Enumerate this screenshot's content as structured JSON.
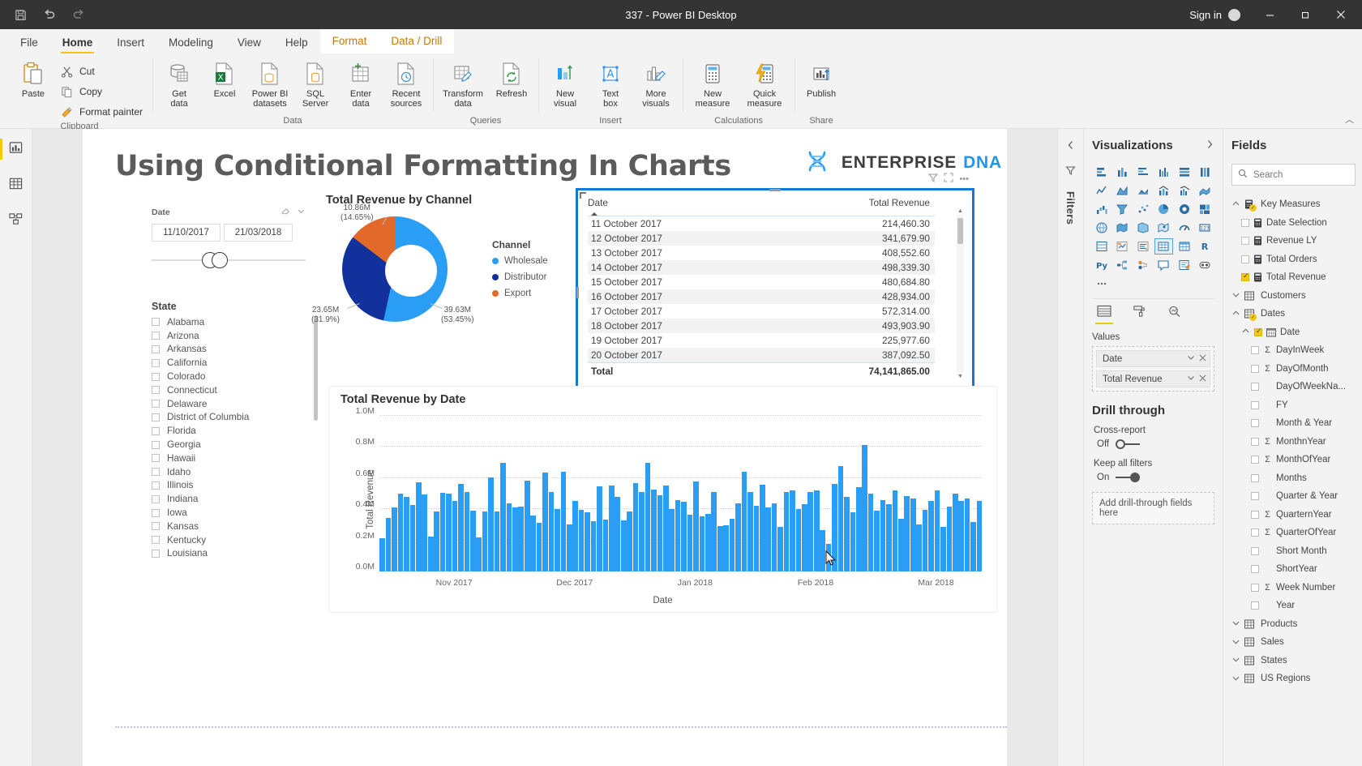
{
  "window": {
    "title": "337 - Power BI Desktop",
    "sign_in": "Sign in",
    "quick_access": [
      "save-icon",
      "undo-icon",
      "redo-icon"
    ],
    "controls": [
      "minimize-icon",
      "restore-icon",
      "close-icon"
    ]
  },
  "ribbon": {
    "tabs": [
      {
        "label": "File",
        "active": false,
        "contextual": false
      },
      {
        "label": "Home",
        "active": true,
        "contextual": false
      },
      {
        "label": "Insert",
        "active": false,
        "contextual": false
      },
      {
        "label": "Modeling",
        "active": false,
        "contextual": false
      },
      {
        "label": "View",
        "active": false,
        "contextual": false
      },
      {
        "label": "Help",
        "active": false,
        "contextual": false
      },
      {
        "label": "Format",
        "active": false,
        "contextual": true
      },
      {
        "label": "Data / Drill",
        "active": false,
        "contextual": true
      }
    ],
    "groups": [
      {
        "label": "Clipboard",
        "big": [
          {
            "label": "Paste",
            "icon": "paste-icon"
          }
        ],
        "small": [
          {
            "label": "Cut",
            "icon": "cut-icon"
          },
          {
            "label": "Copy",
            "icon": "copy-icon"
          },
          {
            "label": "Format painter",
            "icon": "format-painter-icon"
          }
        ]
      },
      {
        "label": "Data",
        "buttons": [
          {
            "label": "Get\ndata",
            "icon": "get-data-icon",
            "caret": true
          },
          {
            "label": "Excel",
            "icon": "excel-icon",
            "caret": false
          },
          {
            "label": "Power BI\ndatasets",
            "icon": "powerbi-datasets-icon",
            "caret": false
          },
          {
            "label": "SQL\nServer",
            "icon": "sql-server-icon",
            "caret": false
          },
          {
            "label": "Enter\ndata",
            "icon": "enter-data-icon",
            "caret": false
          },
          {
            "label": "Recent\nsources",
            "icon": "recent-sources-icon",
            "caret": true
          }
        ]
      },
      {
        "label": "Queries",
        "buttons": [
          {
            "label": "Transform\ndata",
            "icon": "transform-data-icon",
            "caret": true
          },
          {
            "label": "Refresh",
            "icon": "refresh-icon",
            "caret": false
          }
        ]
      },
      {
        "label": "Insert",
        "buttons": [
          {
            "label": "New\nvisual",
            "icon": "new-visual-icon",
            "caret": false
          },
          {
            "label": "Text\nbox",
            "icon": "text-box-icon",
            "caret": false
          },
          {
            "label": "More\nvisuals",
            "icon": "more-visuals-icon",
            "caret": true
          }
        ]
      },
      {
        "label": "Calculations",
        "buttons": [
          {
            "label": "New\nmeasure",
            "icon": "new-measure-icon",
            "caret": false
          },
          {
            "label": "Quick\nmeasure",
            "icon": "quick-measure-icon",
            "caret": false
          }
        ]
      },
      {
        "label": "Share",
        "buttons": [
          {
            "label": "Publish",
            "icon": "publish-icon",
            "caret": false
          }
        ]
      }
    ]
  },
  "leftnav": {
    "items": [
      {
        "name": "report-view",
        "icon": "report-chart-icon",
        "active": true
      },
      {
        "name": "data-view",
        "icon": "data-table-icon",
        "active": false
      },
      {
        "name": "model-view",
        "icon": "model-relationship-icon",
        "active": false
      }
    ]
  },
  "report": {
    "title": "Using Conditional Formatting In Charts",
    "logo": {
      "enterprise": "ENTERPRISE",
      "dna": "DNA",
      "icon": "dna-helix-icon"
    },
    "date_slicer": {
      "label": "Date",
      "start": "11/10/2017",
      "end": "21/03/2018",
      "tools": [
        "eraser-icon",
        "chevron-down-icon"
      ]
    },
    "state_slicer": {
      "title": "State",
      "items": [
        "Alabama",
        "Arizona",
        "Arkansas",
        "California",
        "Colorado",
        "Connecticut",
        "Delaware",
        "District of Columbia",
        "Florida",
        "Georgia",
        "Hawaii",
        "Idaho",
        "Illinois",
        "Indiana",
        "Iowa",
        "Kansas",
        "Kentucky",
        "Louisiana"
      ]
    },
    "table_visual": {
      "columns": [
        "Date",
        "Total Revenue"
      ],
      "rows": [
        [
          "11 October 2017",
          "214,460.30"
        ],
        [
          "12 October 2017",
          "341,679.90"
        ],
        [
          "13 October 2017",
          "408,552.60"
        ],
        [
          "14 October 2017",
          "498,339.30"
        ],
        [
          "15 October 2017",
          "480,684.80"
        ],
        [
          "16 October 2017",
          "428,934.00"
        ],
        [
          "17 October 2017",
          "572,314.00"
        ],
        [
          "18 October 2017",
          "493,903.90"
        ],
        [
          "19 October 2017",
          "225,977.60"
        ],
        [
          "20 October 2017",
          "387,092.50"
        ]
      ],
      "total_label": "Total",
      "total_value": "74,141,865.00"
    }
  },
  "chart_data": [
    {
      "type": "pie",
      "title": "Total Revenue by Channel",
      "legend_title": "Channel",
      "legend_position": "right",
      "slices": [
        {
          "name": "Wholesale",
          "label": "39.63M",
          "percent_label": "(53.45%)",
          "value": 39.63,
          "percent": 53.45,
          "color": "#2a9df4"
        },
        {
          "name": "Distributor",
          "label": "23.65M",
          "percent_label": "(31.9%)",
          "value": 23.65,
          "percent": 31.9,
          "color": "#13319c"
        },
        {
          "name": "Export",
          "label": "10.86M",
          "percent_label": "(14.65%)",
          "value": 10.86,
          "percent": 14.65,
          "color": "#e2692a"
        }
      ]
    },
    {
      "type": "bar",
      "title": "Total Revenue by Date",
      "xlabel": "Date",
      "ylabel": "Total Revenue",
      "ylim": [
        0,
        1000000
      ],
      "yticks": [
        "0.0M",
        "0.2M",
        "0.4M",
        "0.6M",
        "0.8M",
        "1.0M"
      ],
      "xticks": [
        "Nov 2017",
        "Dec 2017",
        "Jan 2018",
        "Feb 2018",
        "Mar 2018"
      ],
      "grid": true,
      "bar_color": "#2a9df4",
      "values": [
        0.214,
        0.342,
        0.409,
        0.498,
        0.481,
        0.429,
        0.572,
        0.494,
        0.226,
        0.387,
        0.505,
        0.498,
        0.452,
        0.562,
        0.509,
        0.392,
        0.221,
        0.386,
        0.604,
        0.385,
        0.699,
        0.44,
        0.409,
        0.415,
        0.582,
        0.36,
        0.31,
        0.634,
        0.511,
        0.4,
        0.641,
        0.303,
        0.452,
        0.397,
        0.38,
        0.325,
        0.548,
        0.336,
        0.554,
        0.478,
        0.33,
        0.388,
        0.566,
        0.512,
        0.699,
        0.525,
        0.489,
        0.551,
        0.4,
        0.46,
        0.446,
        0.365,
        0.577,
        0.356,
        0.368,
        0.51,
        0.291,
        0.296,
        0.338,
        0.44,
        0.641,
        0.512,
        0.422,
        0.557,
        0.41,
        0.438,
        0.286,
        0.513,
        0.523,
        0.402,
        0.432,
        0.511,
        0.52,
        0.264,
        0.175,
        0.56,
        0.679,
        0.479,
        0.38,
        0.543,
        0.815,
        0.501,
        0.392,
        0.457,
        0.43,
        0.522,
        0.338,
        0.487,
        0.471,
        0.303,
        0.397,
        0.452,
        0.52,
        0.288,
        0.417,
        0.499,
        0.455,
        0.468,
        0.32,
        0.455
      ]
    }
  ],
  "filters_rail": {
    "label": "Filters",
    "icon": "filter-funnel-icon",
    "collapse_icon": "chevron-left-icon"
  },
  "visualizations": {
    "title": "Visualizations",
    "expand_icon": "chevron-right-icon",
    "icons": [
      "stacked-bar-chart-icon",
      "stacked-column-chart-icon",
      "clustered-bar-chart-icon",
      "clustered-column-chart-icon",
      "100-stacked-bar-icon",
      "100-stacked-column-icon",
      "line-chart-icon",
      "area-chart-icon",
      "stacked-area-chart-icon",
      "line-stacked-column-icon",
      "line-clustered-column-icon",
      "ribbon-chart-icon",
      "waterfall-chart-icon",
      "funnel-chart-icon",
      "scatter-chart-icon",
      "pie-chart-icon",
      "donut-chart-icon",
      "treemap-icon",
      "map-icon",
      "filled-map-icon",
      "shape-map-icon",
      "azure-map-icon",
      "gauge-icon",
      "card-icon",
      "multi-row-card-icon",
      "kpi-icon",
      "slicer-icon",
      "table-icon",
      "matrix-icon",
      "r-script-visual-icon",
      "python-visual-icon",
      "decomposition-tree-icon",
      "key-influencers-icon",
      "q-and-a-icon",
      "smart-narrative-icon",
      "paginated-report-icon",
      "more-options-icon"
    ],
    "selected_icon": "table-icon",
    "field_tabs": [
      {
        "name": "fields-tab",
        "icon": "fields-grid-icon",
        "active": true
      },
      {
        "name": "format-tab",
        "icon": "paint-roller-icon",
        "active": false
      },
      {
        "name": "analytics-tab",
        "icon": "analytics-magnifier-icon",
        "active": false
      }
    ],
    "values_label": "Values",
    "wells": [
      {
        "name": "Date",
        "caret": "chevron-down-icon",
        "remove": "close-icon"
      },
      {
        "name": "Total Revenue",
        "caret": "chevron-down-icon",
        "remove": "close-icon"
      }
    ],
    "drill_through": {
      "title": "Drill through",
      "cross_report_label": "Cross-report",
      "cross_report_state": "Off",
      "keep_filters_label": "Keep all filters",
      "keep_filters_state": "On",
      "drop_zone": "Add drill-through fields here"
    }
  },
  "fields": {
    "title": "Fields",
    "search_placeholder": "Search",
    "search_icon": "search-icon",
    "tree": [
      {
        "label": "Key Measures",
        "type": "measure-table",
        "level": 0,
        "expanded": true,
        "checked": false
      },
      {
        "label": "Date Selection",
        "type": "measure",
        "level": 1,
        "checked": false
      },
      {
        "label": "Revenue LY",
        "type": "measure",
        "level": 1,
        "checked": false
      },
      {
        "label": "Total Orders",
        "type": "measure",
        "level": 1,
        "checked": false
      },
      {
        "label": "Total Revenue",
        "type": "measure",
        "level": 1,
        "checked": true
      },
      {
        "label": "Customers",
        "type": "table",
        "level": 0,
        "expanded": false,
        "checked": false
      },
      {
        "label": "Dates",
        "type": "table",
        "level": 0,
        "expanded": true,
        "checked": false
      },
      {
        "label": "Date",
        "type": "date-hierarchy",
        "level": 1,
        "expanded": true,
        "checked": true
      },
      {
        "label": "DayInWeek",
        "type": "numeric",
        "level": 2,
        "checked": false
      },
      {
        "label": "DayOfMonth",
        "type": "numeric",
        "level": 2,
        "checked": false
      },
      {
        "label": "DayOfWeekNa...",
        "type": "text",
        "level": 2,
        "checked": false
      },
      {
        "label": "FY",
        "type": "text",
        "level": 2,
        "checked": false
      },
      {
        "label": "Month & Year",
        "type": "text",
        "level": 2,
        "checked": false
      },
      {
        "label": "MonthnYear",
        "type": "numeric",
        "level": 2,
        "checked": false
      },
      {
        "label": "MonthOfYear",
        "type": "numeric",
        "level": 2,
        "checked": false
      },
      {
        "label": "Months",
        "type": "text",
        "level": 2,
        "checked": false
      },
      {
        "label": "Quarter & Year",
        "type": "text",
        "level": 2,
        "checked": false
      },
      {
        "label": "QuarternYear",
        "type": "numeric",
        "level": 2,
        "checked": false
      },
      {
        "label": "QuarterOfYear",
        "type": "numeric",
        "level": 2,
        "checked": false
      },
      {
        "label": "Short Month",
        "type": "text",
        "level": 2,
        "checked": false
      },
      {
        "label": "ShortYear",
        "type": "text",
        "level": 2,
        "checked": false
      },
      {
        "label": "Week Number",
        "type": "numeric",
        "level": 2,
        "checked": false
      },
      {
        "label": "Year",
        "type": "text",
        "level": 2,
        "checked": false
      },
      {
        "label": "Products",
        "type": "table",
        "level": 0,
        "expanded": false,
        "checked": false
      },
      {
        "label": "Sales",
        "type": "table",
        "level": 0,
        "expanded": false,
        "checked": false
      },
      {
        "label": "States",
        "type": "table",
        "level": 0,
        "expanded": false,
        "checked": false
      },
      {
        "label": "US Regions",
        "type": "table",
        "level": 0,
        "expanded": false,
        "checked": false
      }
    ]
  }
}
